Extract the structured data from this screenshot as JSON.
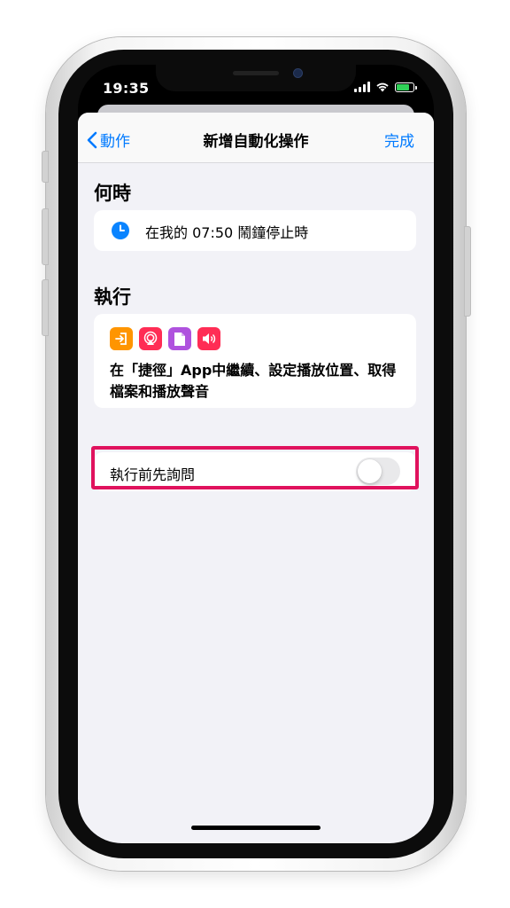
{
  "status_bar": {
    "time": "19:35",
    "battery_color": "#30d158"
  },
  "nav": {
    "back_label": "動作",
    "title": "新增自動化操作",
    "done_label": "完成",
    "accent": "#007aff"
  },
  "when": {
    "section_title": "何時",
    "trigger_text": "在我的 07:50 鬧鐘停止時",
    "icon": "clock-icon"
  },
  "do": {
    "section_title": "執行",
    "action_icons": [
      {
        "name": "continue-in-app-icon",
        "color": "#ff9500"
      },
      {
        "name": "airplay-icon",
        "color": "#ff2d55"
      },
      {
        "name": "document-icon",
        "color": "#af52de"
      },
      {
        "name": "sound-icon",
        "color": "#ff2d55"
      }
    ],
    "summary": "在「捷徑」App中繼續、設定播放位置、取得檔案和播放聲音"
  },
  "ask": {
    "label": "執行前先詢問",
    "toggle_on": false,
    "highlight_color": "#e0125d"
  }
}
